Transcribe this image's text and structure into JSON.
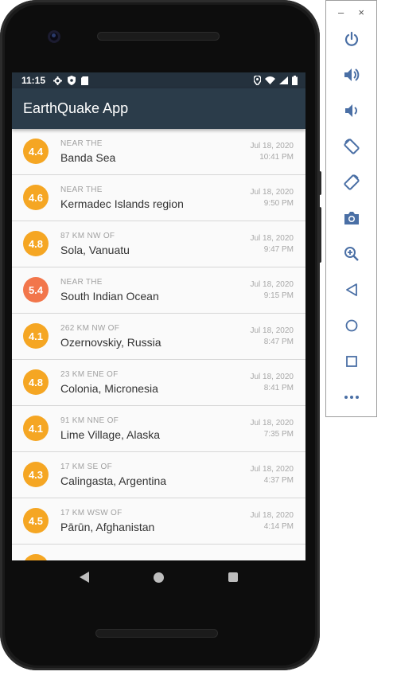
{
  "status_bar": {
    "time": "11:15"
  },
  "app": {
    "title": "EarthQuake App"
  },
  "colors": {
    "statusbar": "#24313d",
    "appbar": "#2b3c4a",
    "mag_orange": "#f5a623",
    "mag_red": "#f2764b",
    "emulator_icon": "#4a6fa5"
  },
  "earthquakes": [
    {
      "magnitude": "4.4",
      "offset": "NEAR THE",
      "place": "Banda Sea",
      "date": "Jul 18, 2020",
      "time": "10:41 PM",
      "color": "#f5a623"
    },
    {
      "magnitude": "4.6",
      "offset": "NEAR THE",
      "place": "Kermadec Islands region",
      "date": "Jul 18, 2020",
      "time": "9:50 PM",
      "color": "#f5a623"
    },
    {
      "magnitude": "4.8",
      "offset": "87 KM NW OF",
      "place": "Sola, Vanuatu",
      "date": "Jul 18, 2020",
      "time": "9:47 PM",
      "color": "#f5a623"
    },
    {
      "magnitude": "5.4",
      "offset": "NEAR THE",
      "place": "South Indian Ocean",
      "date": "Jul 18, 2020",
      "time": "9:15 PM",
      "color": "#f2764b"
    },
    {
      "magnitude": "4.1",
      "offset": "262 KM NW OF",
      "place": "Ozernovskiy, Russia",
      "date": "Jul 18, 2020",
      "time": "8:47 PM",
      "color": "#f5a623"
    },
    {
      "magnitude": "4.8",
      "offset": "23 KM ENE OF",
      "place": "Colonia, Micronesia",
      "date": "Jul 18, 2020",
      "time": "8:41 PM",
      "color": "#f5a623"
    },
    {
      "magnitude": "4.1",
      "offset": "91 KM NNE OF",
      "place": "Lime Village, Alaska",
      "date": "Jul 18, 2020",
      "time": "7:35 PM",
      "color": "#f5a623"
    },
    {
      "magnitude": "4.3",
      "offset": "17 KM SE OF",
      "place": "Calingasta, Argentina",
      "date": "Jul 18, 2020",
      "time": "4:37 PM",
      "color": "#f5a623"
    },
    {
      "magnitude": "4.5",
      "offset": "17 KM WSW OF",
      "place": "Pārūn, Afghanistan",
      "date": "Jul 18, 2020",
      "time": "4:14 PM",
      "color": "#f5a623"
    },
    {
      "magnitude": "",
      "offset": "",
      "place": "",
      "date": "",
      "time": "",
      "color": "#f5a623"
    }
  ],
  "emulator": {
    "minimize_label": "–",
    "close_label": "×",
    "buttons": [
      "power-icon",
      "volume-up-icon",
      "volume-down-icon",
      "rotate-left-icon",
      "rotate-right-icon",
      "camera-icon",
      "zoom-icon",
      "back-icon",
      "home-icon",
      "overview-icon",
      "more-icon"
    ]
  }
}
